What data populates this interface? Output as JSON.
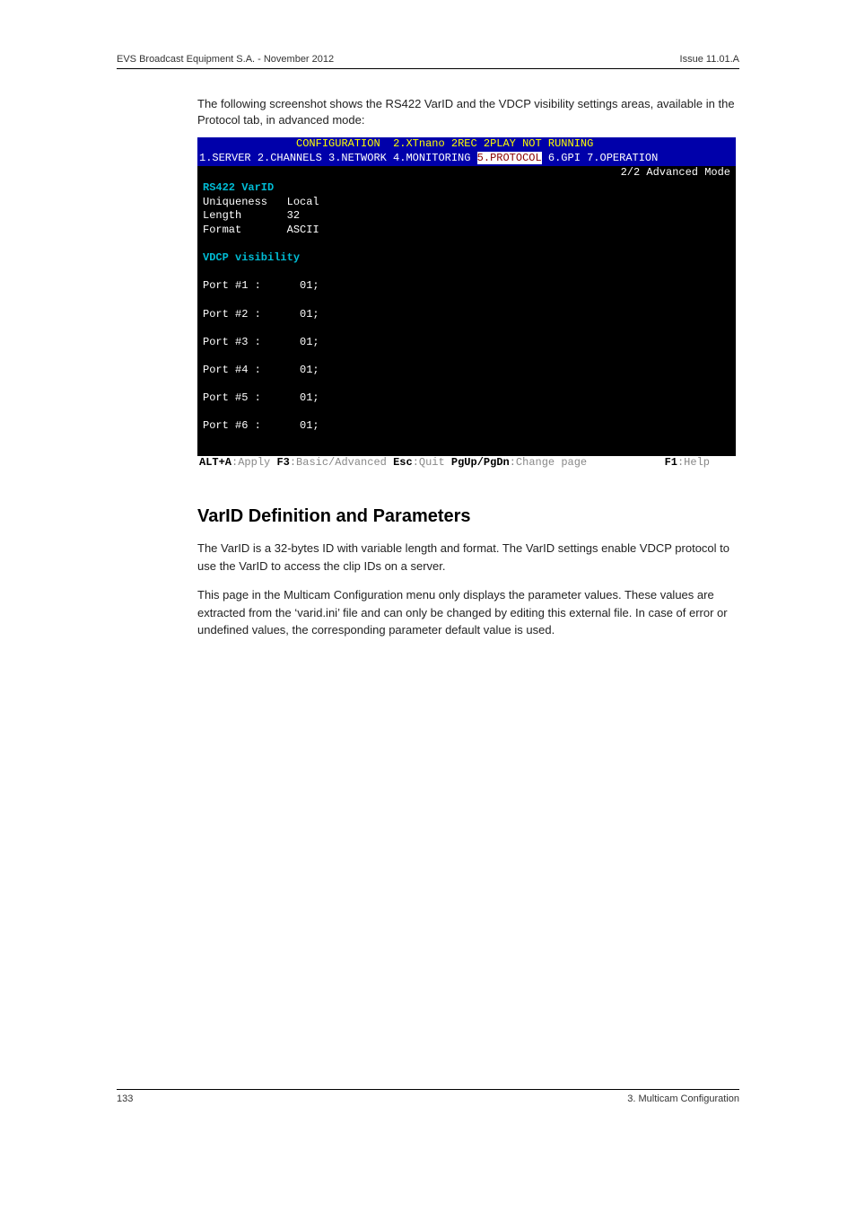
{
  "header": {
    "left": "EVS Broadcast Equipment S.A. - November 2012",
    "right": "Issue 11.01.A"
  },
  "intro": "The following screenshot shows the RS422 VarID and the VDCP visibility settings areas, available in the Protocol tab, in advanced mode:",
  "terminal": {
    "title_left": "CONFIGURATION",
    "title_right": "2.XTnano 2REC 2PLAY NOT RUNNING",
    "menu": {
      "items": [
        "1.SERVER",
        "2.CHANNELS",
        "3.NETWORK",
        "4.MONITORING",
        "5.PROTOCOL",
        "6.GPI",
        "7.OPERATION"
      ],
      "selected_index": 4
    },
    "mode": "2/2 Advanced Mode",
    "section1": {
      "heading": "RS422 VarID",
      "rows": [
        {
          "label": "Uniqueness",
          "value": "Local"
        },
        {
          "label": "Length",
          "value": "32"
        },
        {
          "label": "Format",
          "value": "ASCII"
        }
      ]
    },
    "section2": {
      "heading": "VDCP visibility",
      "ports": [
        {
          "label": "Port #1 :",
          "value": "01;"
        },
        {
          "label": "Port #2 :",
          "value": "01;"
        },
        {
          "label": "Port #3 :",
          "value": "01;"
        },
        {
          "label": "Port #4 :",
          "value": "01;"
        },
        {
          "label": "Port #5 :",
          "value": "01;"
        },
        {
          "label": "Port #6 :",
          "value": "01;"
        }
      ]
    },
    "footer": [
      {
        "key": "ALT+A",
        "label": ":Apply"
      },
      {
        "key": "F3",
        "label": ":Basic/Advanced"
      },
      {
        "key": "Esc",
        "label": ":Quit"
      },
      {
        "key": "PgUp/PgDn",
        "label": ":Change page"
      },
      {
        "key": "F1",
        "label": ":Help"
      }
    ]
  },
  "section_heading": "VarID Definition and Parameters",
  "para1": "The VarID is a 32-bytes ID with variable length and format. The VarID settings enable VDCP protocol to use the VarID to access the clip IDs on a server.",
  "para2": "This page in the Multicam Configuration menu only displays the parameter values. These values are extracted from the ‘varid.ini’ file and can only be changed by editing this external file. In case of error or undefined values, the corresponding parameter default value is used.",
  "footer": {
    "left": "133",
    "right": "3. Multicam Configuration"
  }
}
